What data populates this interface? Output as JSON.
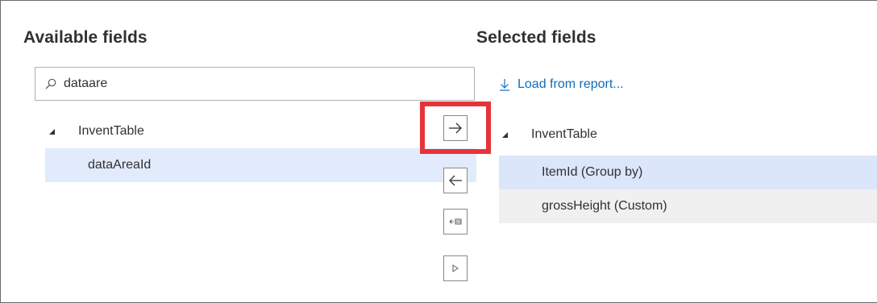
{
  "available": {
    "heading": "Available fields",
    "search": {
      "value": "dataare",
      "placeholder": ""
    },
    "tree": {
      "table": "InventTable",
      "fields": [
        "dataAreaId"
      ]
    }
  },
  "selected": {
    "heading": "Selected fields",
    "load_link": "Load from report...",
    "tree": {
      "table": "InventTable",
      "fields": [
        "ItemId (Group by)",
        "grossHeight (Custom)"
      ]
    }
  },
  "icons": {
    "search": "search-icon",
    "load": "arrow-down-icon",
    "caret": "caret-expanded-icon",
    "add": "arrow-right-icon",
    "remove": "arrow-left-icon",
    "remove_all": "remove-all-icon",
    "expand": "triangle-right-icon"
  },
  "colors": {
    "link": "#0f6cbd",
    "highlight_border": "#e8323a",
    "selected_row": "#e1ebfc",
    "alt_row": "#f0f0f0"
  }
}
